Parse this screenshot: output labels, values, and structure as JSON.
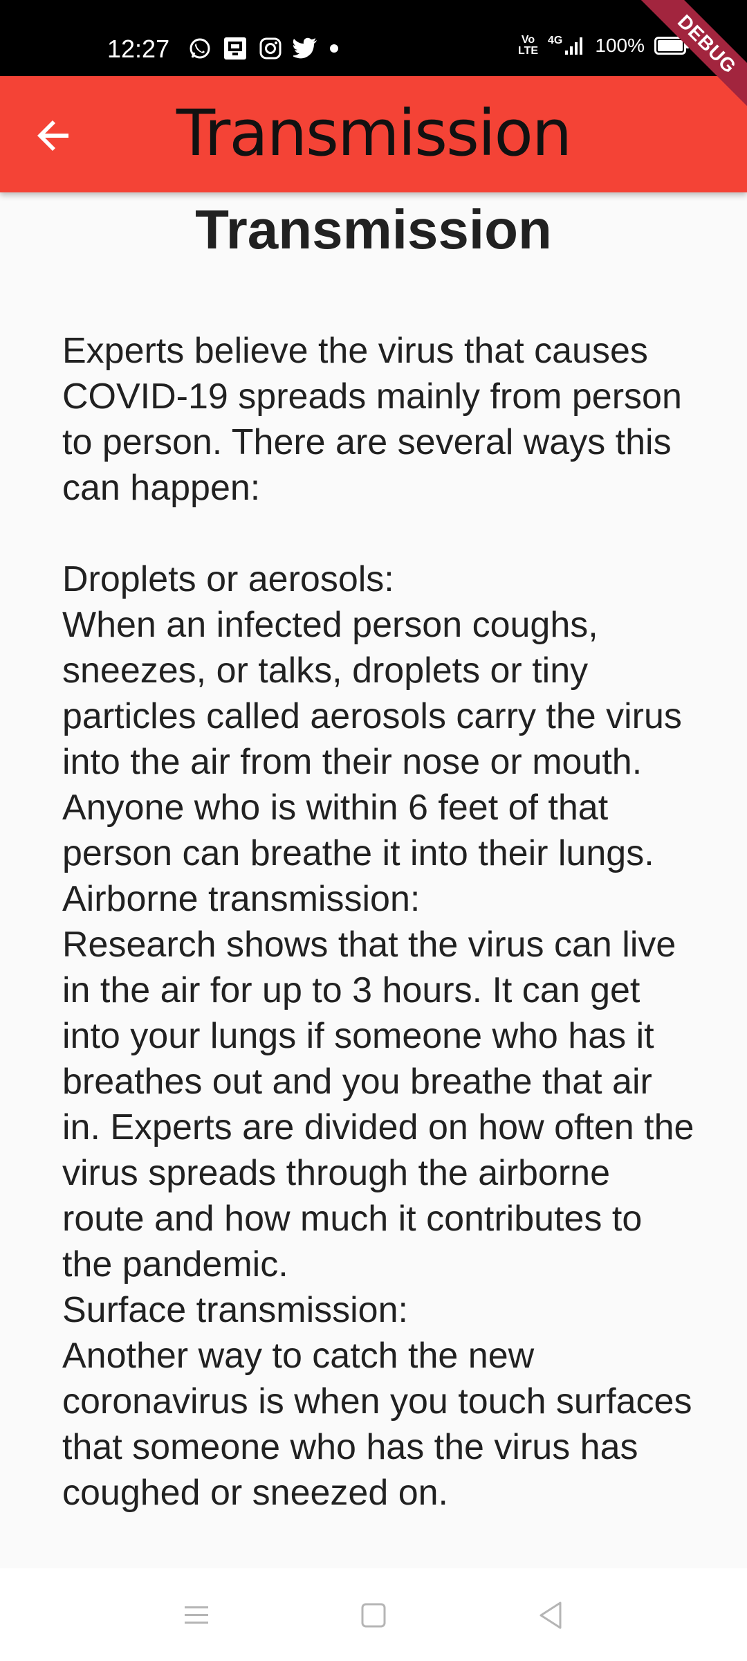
{
  "status_bar": {
    "time": "12:27",
    "notification_icons": [
      "whatsapp-icon",
      "message-icon",
      "instagram-icon",
      "twitter-icon",
      "dot-icon"
    ],
    "network_label_top": "Vo",
    "network_label_bottom": "LTE",
    "signal_label": "4G",
    "battery_percent": "100%"
  },
  "debug_banner": "DEBUG",
  "app_bar": {
    "title": "Transmission",
    "back_icon": "arrow-back-icon",
    "background": "#f44336"
  },
  "content": {
    "heading": "Transmission",
    "body": "Experts believe the virus that causes COVID-19 spreads mainly from person to person. There are several ways this can happen:\n\nDroplets or aerosols:\nWhen an infected person coughs, sneezes, or talks, droplets or tiny particles called aerosols carry the virus into the air from their nose or mouth. Anyone who is within 6 feet of that person can breathe it into their lungs.\nAirborne transmission:\nResearch shows that the virus can live in the air for up to 3 hours. It can get into your lungs if someone who has it breathes out and you breathe that air in. Experts are divided on how often the virus spreads through the airborne route and how much it contributes to the pandemic.\nSurface transmission:\nAnother way to catch the new coronavirus is when you touch surfaces that someone who has the virus has coughed or sneezed on."
  },
  "nav_bar": {
    "icons": [
      "menu-icon",
      "home-icon",
      "back-triangle-icon"
    ]
  }
}
